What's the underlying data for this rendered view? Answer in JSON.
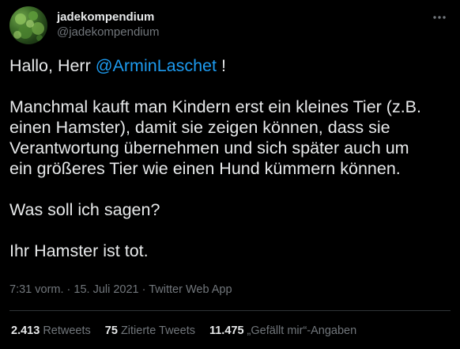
{
  "user": {
    "display_name": "jadekompendium",
    "handle": "@jadekompendium",
    "avatar_icon": "plant-avatar"
  },
  "tweet": {
    "line1_prefix": "Hallo, Herr ",
    "mention": "@ArminLaschet",
    "line1_suffix": " !",
    "para2_lines": [
      "Manchmal kauft man Kindern erst ein kleines Tier (z.B.",
      "einen Hamster), damit sie zeigen können, dass sie",
      "Verantwortung übernehmen und sich später auch um",
      "ein größeres Tier wie einen Hund kümmern können."
    ],
    "para3": "Was soll ich sagen?",
    "para4": "Ihr Hamster ist tot."
  },
  "meta": {
    "time": "7:31 vorm.",
    "separator": " · ",
    "date": "15. Juli 2021",
    "source": "Twitter Web App"
  },
  "stats": {
    "retweets_count": "2.413",
    "retweets_label": " Retweets",
    "quotes_count": "75",
    "quotes_label": " Zitierte Tweets",
    "likes_count": "11.475",
    "likes_label": " „Gefällt mir“-Angaben"
  },
  "colors": {
    "background": "#000000",
    "text": "#e7e9ea",
    "muted": "#71767b",
    "link": "#1d9bf0",
    "divider": "#2f3336"
  }
}
